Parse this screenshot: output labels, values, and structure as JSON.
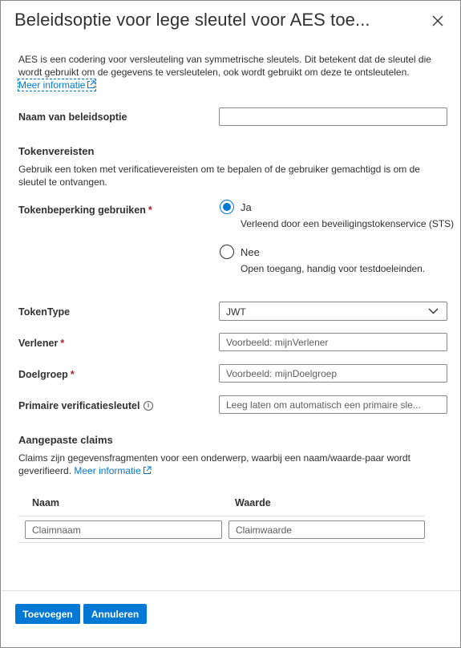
{
  "panel": {
    "title": "Beleidsoptie voor lege sleutel voor AES toe...",
    "description": "AES is een codering voor versleuteling van symmetrische sleutels. Dit betekent dat de sleutel die wordt gebruikt om de gegevens te versleutelen, ook wordt gebruikt om deze te ontsleutelen.",
    "more_info": "Meer informatie"
  },
  "policy_name": {
    "label": "Naam van beleidsoptie",
    "value": ""
  },
  "token_requirements": {
    "heading": "Tokenvereisten",
    "description": "Gebruik een token met verificatievereisten om te bepalen of de gebruiker gemachtigd is om de sleutel te ontvangen."
  },
  "token_restriction": {
    "label": "Tokenbeperking gebruiken",
    "required_mark": "*",
    "options": [
      {
        "label": "Ja",
        "sub": "Verleend door een beveiligingstokenservice (STS)",
        "selected": true
      },
      {
        "label": "Nee",
        "sub": "Open toegang, handig voor testdoeleinden.",
        "selected": false
      }
    ]
  },
  "token_type": {
    "label": "TokenType",
    "value": "JWT"
  },
  "issuer": {
    "label": "Verlener",
    "required_mark": "*",
    "placeholder": "Voorbeeld: mijnVerlener"
  },
  "audience": {
    "label": "Doelgroep",
    "required_mark": "*",
    "placeholder": "Voorbeeld: mijnDoelgroep"
  },
  "primary_key": {
    "label": "Primaire verificatiesleutel",
    "info_glyph": "i",
    "placeholder": "Leeg laten om automatisch een primaire sle..."
  },
  "custom_claims": {
    "heading": "Aangepaste claims",
    "description": "Claims zijn gegevensfragmenten voor een onderwerp, waarbij een naam/waarde-paar wordt geverifieerd.",
    "more_info": "Meer informatie",
    "columns": [
      "Naam",
      "Waarde"
    ],
    "name_placeholder": "Claimnaam",
    "value_placeholder": "Claimwaarde"
  },
  "actions": {
    "add": "Toevoegen",
    "cancel": "Annuleren"
  },
  "colors": {
    "accent": "#0078d4",
    "required": "#a4262c",
    "border": "#8a8886"
  },
  "icons": {
    "close": "close-icon",
    "external": "external-link-icon",
    "chevron": "chevron-down-icon",
    "info": "info-icon"
  }
}
